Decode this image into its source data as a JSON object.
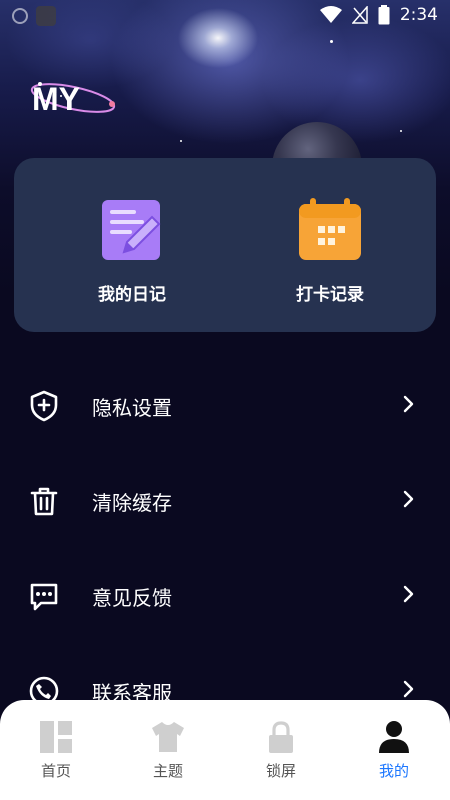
{
  "status_bar": {
    "time": "2:34"
  },
  "brand": {
    "logo_text": "MY"
  },
  "quick_actions": [
    {
      "label": "我的日记",
      "icon": "diary-icon"
    },
    {
      "label": "打卡记录",
      "icon": "calendar-icon"
    }
  ],
  "menu": [
    {
      "label": "隐私设置",
      "icon": "shield-plus-icon"
    },
    {
      "label": "清除缓存",
      "icon": "trash-icon"
    },
    {
      "label": "意见反馈",
      "icon": "chat-dots-icon"
    },
    {
      "label": "联系客服",
      "icon": "phone-icon"
    }
  ],
  "tabbar": {
    "tabs": [
      {
        "label": "首页",
        "icon": "home-grid-icon",
        "active": false
      },
      {
        "label": "主题",
        "icon": "shirt-icon",
        "active": false
      },
      {
        "label": "锁屏",
        "icon": "lock-icon",
        "active": false
      },
      {
        "label": "我的",
        "icon": "person-icon",
        "active": true
      }
    ],
    "active_color": "#1c77ff",
    "inactive_color": "#555555"
  },
  "colors": {
    "card_bg": "#263250",
    "diary_icon": "#a87cf7",
    "calendar_icon": "#f7a437"
  }
}
